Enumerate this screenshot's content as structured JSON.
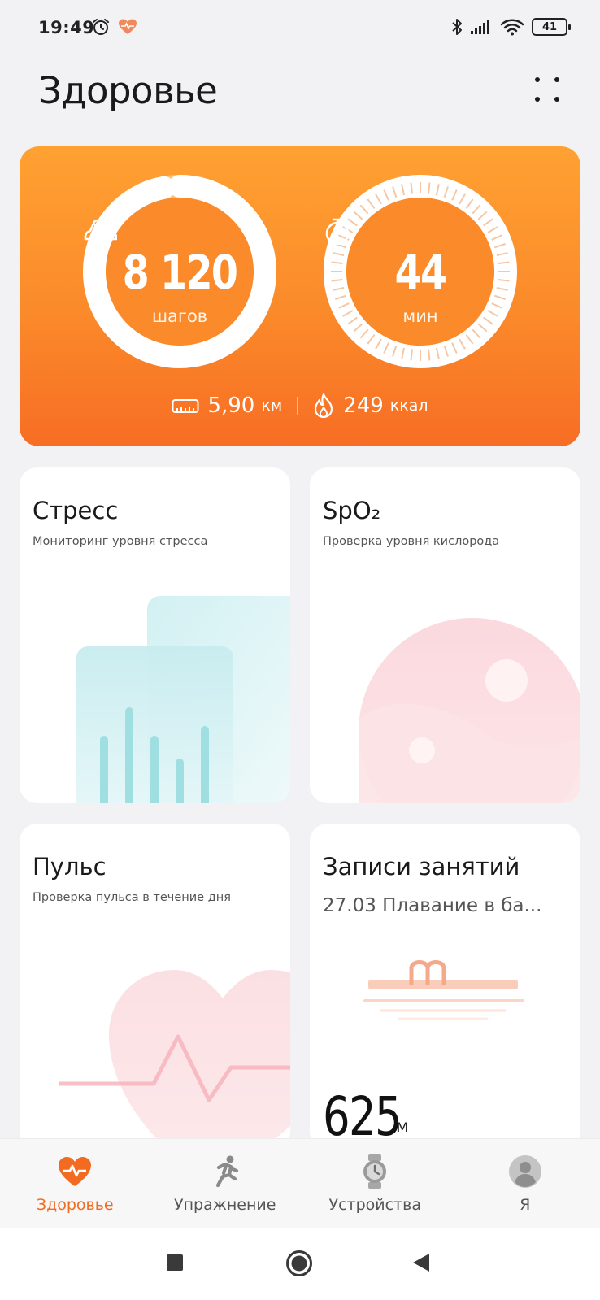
{
  "status_bar": {
    "time": "19:49",
    "battery": "41",
    "icons": [
      "alarm-icon",
      "health-heart-icon",
      "bluetooth-icon",
      "signal-icon",
      "wifi-icon",
      "battery-icon"
    ]
  },
  "header": {
    "title": "Здоровье",
    "menu_icon": "grid-dots-icon"
  },
  "activity": {
    "steps_value": "8 120",
    "steps_unit": "шагов",
    "steps_progress": 0.97,
    "time_value": "44",
    "time_unit": "мин",
    "time_progress": 0.5,
    "distance_value": "5,90",
    "distance_unit": "км",
    "calories_value": "249",
    "calories_unit": "ккал",
    "colors": {
      "start": "#ffa132",
      "end": "#f76d24"
    }
  },
  "tiles": {
    "stress": {
      "title": "Стресс",
      "subtitle": "Мониторинг уровня стресса"
    },
    "spo2": {
      "title": "SpO₂",
      "subtitle": "Проверка уровня кислорода"
    },
    "pulse": {
      "title": "Пульс",
      "subtitle": "Проверка пульса в течение дня"
    },
    "workouts": {
      "title": "Записи занятий",
      "subtitle": "27.03 Плавание в ба...",
      "distance_value": "625",
      "distance_unit": "м"
    }
  },
  "bottom_nav": {
    "items": [
      {
        "label": "Здоровье",
        "icon": "heart-pulse-icon",
        "active": true
      },
      {
        "label": "Упражнение",
        "icon": "running-icon",
        "active": false
      },
      {
        "label": "Устройства",
        "icon": "watch-icon",
        "active": false
      },
      {
        "label": "Я",
        "icon": "avatar-icon",
        "active": false
      }
    ],
    "accent": "#f26b21"
  },
  "system_nav": {
    "icons": [
      "recent-apps-icon",
      "home-icon",
      "back-icon"
    ]
  }
}
